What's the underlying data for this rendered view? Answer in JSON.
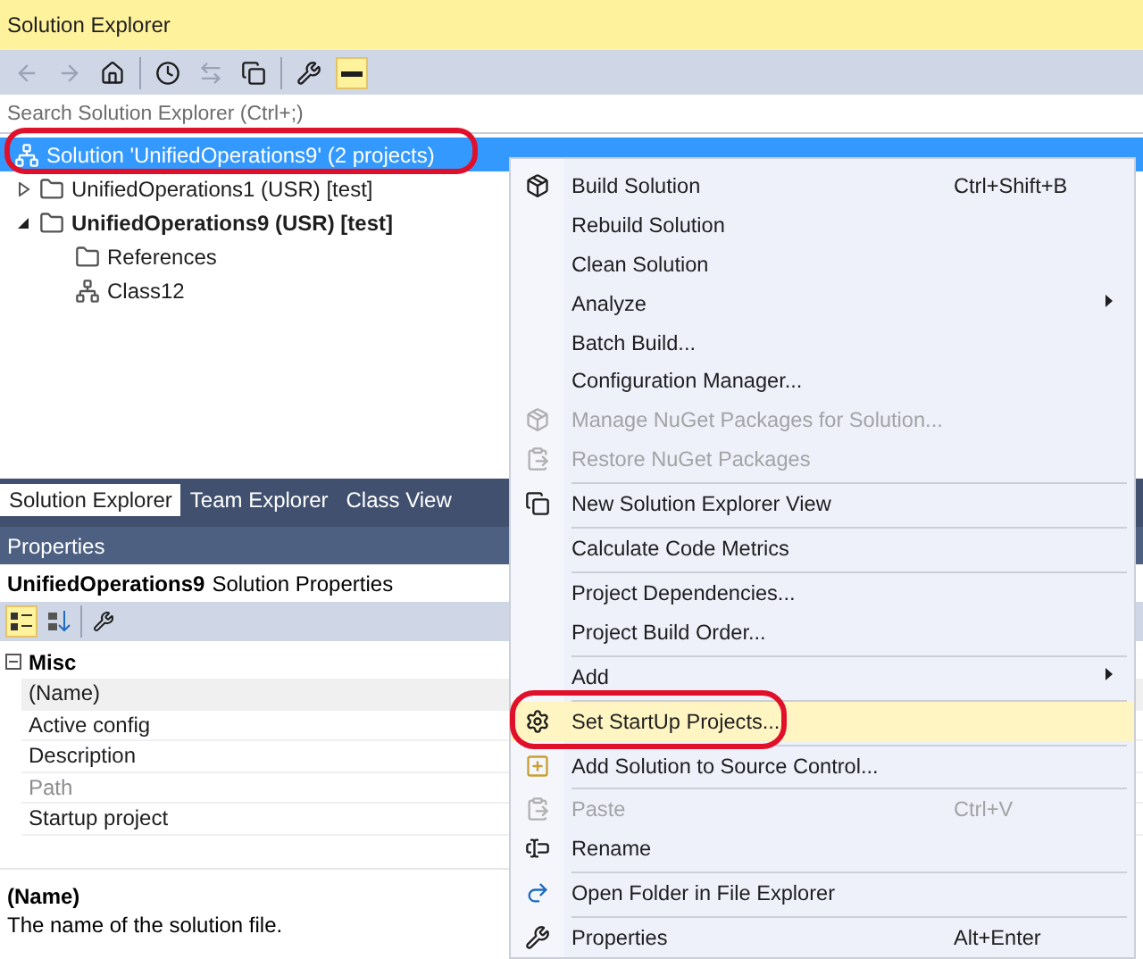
{
  "window": {
    "title": "Solution Explorer"
  },
  "search": {
    "placeholder": "Search Solution Explorer (Ctrl+;)"
  },
  "tree": [
    {
      "label": "Solution 'UnifiedOperations9' (2 projects)",
      "selected": true,
      "startup": false,
      "children": [
        {
          "label": "UnifiedOperations1 (USR) [test]",
          "selected": false,
          "startup": false,
          "expanded": false
        },
        {
          "label": "UnifiedOperations9 (USR) [test]",
          "selected": false,
          "startup": true,
          "expanded": true,
          "children": [
            {
              "label": "References",
              "selected": false,
              "startup": false
            },
            {
              "label": "Class12",
              "selected": false,
              "startup": false
            }
          ]
        }
      ]
    }
  ],
  "tabs": [
    {
      "label": "Solution Explorer",
      "selected": true
    },
    {
      "label": "Team Explorer",
      "selected": false
    },
    {
      "label": "Class View",
      "selected": false
    }
  ],
  "properties": {
    "title": "Properties",
    "object_name": "UnifiedOperations9",
    "object_type": "Solution Properties",
    "category": {
      "label": "Misc",
      "expanded": true
    },
    "rows": [
      {
        "label": "(Name)",
        "selected": true,
        "disabled": false
      },
      {
        "label": "Active config",
        "selected": false,
        "disabled": false
      },
      {
        "label": "Description",
        "selected": false,
        "disabled": false
      },
      {
        "label": "Path",
        "selected": false,
        "disabled": true
      },
      {
        "label": "Startup project",
        "selected": false,
        "disabled": false
      }
    ],
    "description_title": "(Name)",
    "description_text": "The name of the solution file."
  },
  "context_menu": [
    {
      "kind": "item",
      "label": "Build Solution",
      "shortcut": "Ctrl+Shift+B",
      "disabled": false,
      "selected": false,
      "submenu": false
    },
    {
      "kind": "item",
      "label": "Rebuild Solution",
      "disabled": false,
      "selected": false,
      "submenu": false
    },
    {
      "kind": "item",
      "label": "Clean Solution",
      "disabled": false,
      "selected": false,
      "submenu": false
    },
    {
      "kind": "item",
      "label": "Analyze",
      "disabled": false,
      "selected": false,
      "submenu": true
    },
    {
      "kind": "item",
      "label": "Batch Build...",
      "disabled": false,
      "selected": false,
      "submenu": false
    },
    {
      "kind": "item",
      "label": "Configuration Manager...",
      "disabled": false,
      "selected": false,
      "submenu": false
    },
    {
      "kind": "item",
      "label": "Manage NuGet Packages for Solution...",
      "disabled": true,
      "selected": false,
      "submenu": false
    },
    {
      "kind": "item",
      "label": "Restore NuGet Packages",
      "disabled": true,
      "selected": false,
      "submenu": false
    },
    {
      "kind": "separator"
    },
    {
      "kind": "item",
      "label": "New Solution Explorer View",
      "disabled": false,
      "selected": false,
      "submenu": false
    },
    {
      "kind": "separator"
    },
    {
      "kind": "item",
      "label": "Calculate Code Metrics",
      "disabled": false,
      "selected": false,
      "submenu": false
    },
    {
      "kind": "separator"
    },
    {
      "kind": "item",
      "label": "Project Dependencies...",
      "disabled": false,
      "selected": false,
      "submenu": false
    },
    {
      "kind": "item",
      "label": "Project Build Order...",
      "disabled": false,
      "selected": false,
      "submenu": false
    },
    {
      "kind": "separator"
    },
    {
      "kind": "item",
      "label": "Add",
      "disabled": false,
      "selected": false,
      "submenu": true
    },
    {
      "kind": "separator"
    },
    {
      "kind": "item",
      "label": "Set StartUp Projects...",
      "disabled": false,
      "selected": true,
      "submenu": false
    },
    {
      "kind": "separator"
    },
    {
      "kind": "item",
      "label": "Add Solution to Source Control...",
      "disabled": false,
      "selected": false,
      "submenu": false
    },
    {
      "kind": "separator"
    },
    {
      "kind": "item",
      "label": "Paste",
      "shortcut": "Ctrl+V",
      "disabled": true,
      "selected": false,
      "submenu": false
    },
    {
      "kind": "item",
      "label": "Rename",
      "disabled": false,
      "selected": false,
      "submenu": false
    },
    {
      "kind": "separator"
    },
    {
      "kind": "item",
      "label": "Open Folder in File Explorer",
      "disabled": false,
      "selected": false,
      "submenu": false
    },
    {
      "kind": "separator"
    },
    {
      "kind": "item",
      "label": "Properties",
      "shortcut": "Alt+Enter",
      "disabled": false,
      "selected": false,
      "submenu": false
    }
  ]
}
